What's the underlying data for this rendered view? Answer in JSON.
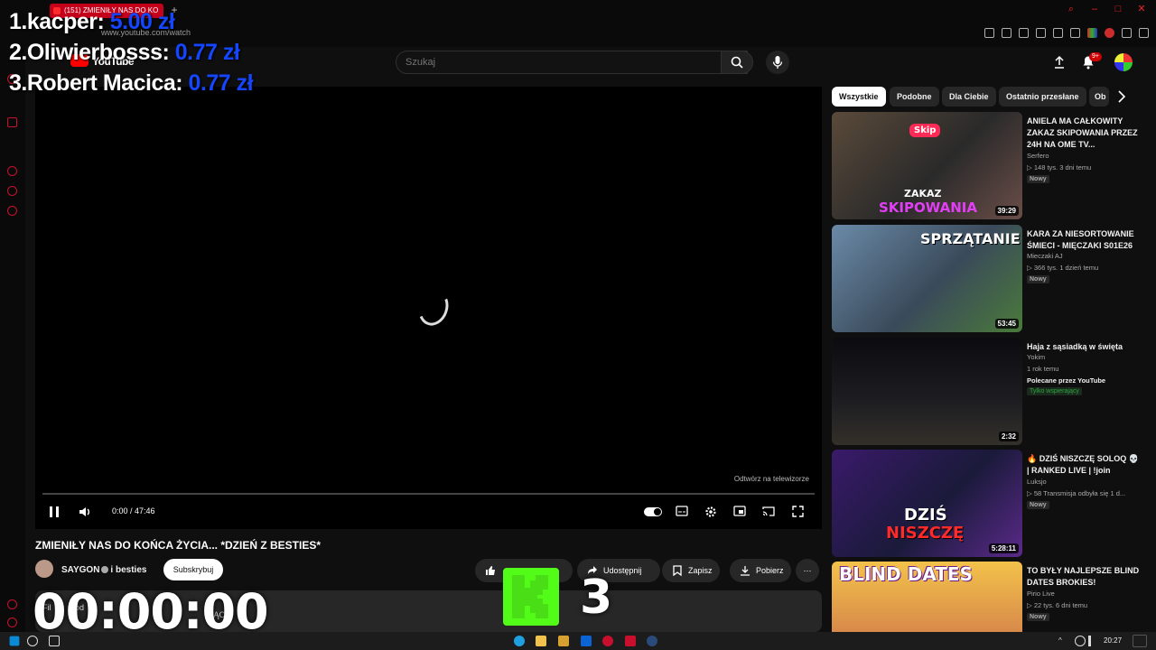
{
  "browser": {
    "tab_title": "(151) ZMIENIŁY NAS DO KO",
    "url": "www.youtube.com/watch"
  },
  "youtube": {
    "logo_text": "YouTube",
    "search_placeholder": "Szukaj",
    "notifications_count": "9+"
  },
  "player": {
    "time": "0:00 / 47:46",
    "cast_hint": "Odtwórz na telewizorze"
  },
  "video": {
    "title": "ZMIENIŁY NAS DO KOŃCA ŻYCIA... *DZIEŃ Z BESTIES*",
    "channel": "SAYGON",
    "channel_suffix": "i besties",
    "subscribe_label": "Subskrybuj",
    "share_label": "Udostępnij",
    "save_label": "Zapisz",
    "download_label": "Pobierz",
    "more_label": "⋯",
    "description_snippet": "Fil",
    "description_snippet2": "od",
    "description_snippet3": "ŻĄCO"
  },
  "chips": [
    "Wszystkie",
    "Podobne",
    "Dla Ciebie",
    "Ostatnio przesłane",
    "Ob"
  ],
  "recommendations": [
    {
      "title": "ANIELA MA CAŁKOWITY ZAKAZ SKIPOWANIA PRZEZ 24H NA OME TV...",
      "channel": "Serfero",
      "meta": "▷ 148 tys.  3 dni temu",
      "badge": "Nowy",
      "duration": "39:29",
      "thumb_text": "SKIPOWANIA",
      "thumb_text2": "ZAKAZ",
      "thumb_tag": "Skip"
    },
    {
      "title": "KARA ZA NIESORTOWANIE ŚMIECI - MIĘCZAKI S01E26",
      "channel": "Mieczaki AJ",
      "meta": "▷ 366 tys.  1 dzień temu",
      "badge": "Nowy",
      "duration": "53:45",
      "thumb_text": "SPRZĄTANIE"
    },
    {
      "title": "Haja z sąsiadką w święta",
      "channel": "Yokim",
      "meta": "1 rok temu",
      "promo": "Polecane przez YouTube",
      "green": "Tylko wspierający",
      "duration": "2:32"
    },
    {
      "title": "🔥 DZIŚ NISZCZĘ SOLOQ 💀 | RANKED LIVE | !join",
      "channel": "Luksjo",
      "meta": "▷ 58  Transmisja odbyła się 1 d...",
      "badge": "Nowy",
      "duration": "5:28:11",
      "thumb_text": "DZIŚ",
      "thumb_text2": "NISZCZĘ"
    },
    {
      "title": "TO BYŁY NAJLEPSZE BLIND DATES BROKIES!",
      "channel": "Pirio Live",
      "meta": "▷ 22 tys.  6 dni temu",
      "badge": "Nowy",
      "thumb_text": "BLIND DATES"
    }
  ],
  "overlay": {
    "donors": [
      {
        "rank": "1.",
        "name": "kacper:",
        "amount": "5.00 zł"
      },
      {
        "rank": "2.",
        "name": "Oliwierbosss:",
        "amount": "0.77 zł"
      },
      {
        "rank": "3.",
        "name": "Robert Macica:",
        "amount": "0.77 zł"
      }
    ],
    "timer": "00:00:00",
    "kick_count": "3"
  },
  "taskbar": {
    "clock": "20:27"
  },
  "colors": {
    "youtube_red": "#ff0000",
    "kick_green": "#53fc18",
    "donor_amount": "#1446ff",
    "opera_red": "#c8102e"
  }
}
